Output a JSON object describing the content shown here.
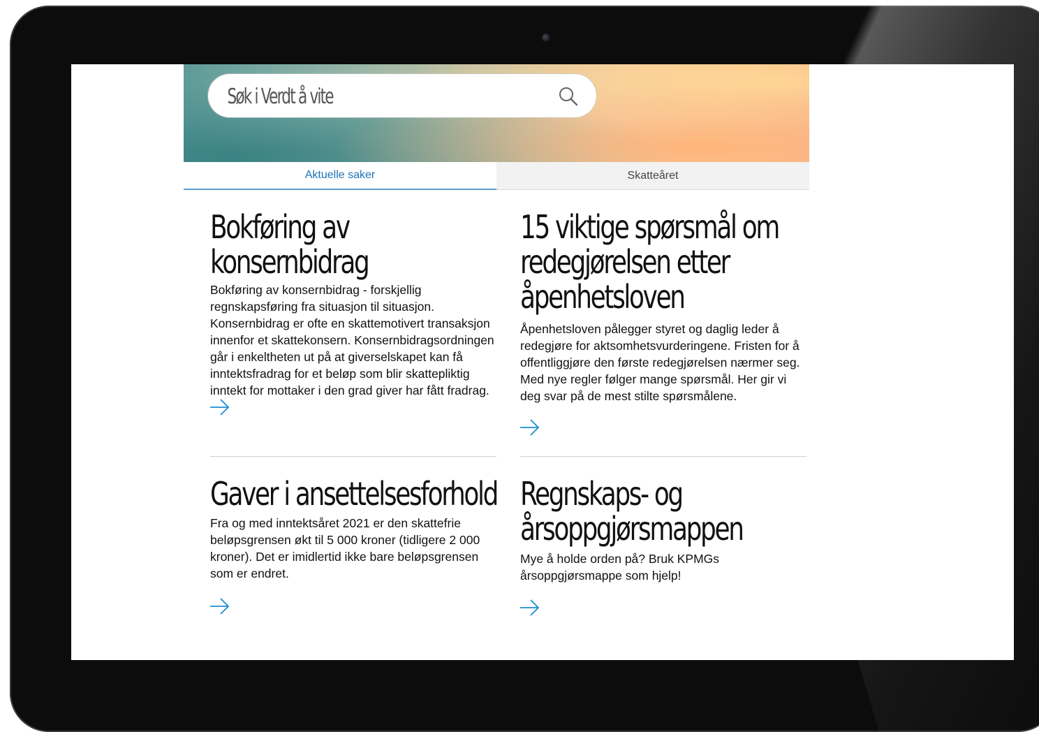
{
  "search": {
    "placeholder": "Søk i Verdt å vite"
  },
  "tabs": [
    {
      "label": "Aktuelle saker",
      "active": true
    },
    {
      "label": "Skatteåret",
      "active": false
    }
  ],
  "articles": [
    {
      "title": "Bokføring av konsernbidrag",
      "text": "Bokføring av konsernbidrag - forskjellig regnskapsføring fra situasjon til situasjon. Konsernbidrag er ofte en skattemotivert transaksjon innenfor et skattekonsern. Konsernbidragsordningen går i enkeltheten ut på at giverselskapet kan få inntektsfradrag for et beløp som blir skattepliktig inntekt for mottaker i den grad giver har fått fradrag."
    },
    {
      "title": "15 viktige spørsmål om redegjørelsen etter åpenhetsloven",
      "text": "Åpenhetsloven pålegger styret og daglig leder å redegjøre for aktsomhetsvurderingene. Fristen for å offentliggjøre den første redegjørelsen nærmer seg. Med nye regler følger mange spørsmål. Her gir vi deg svar på de mest stilte spørsmålene."
    },
    {
      "title": "Gaver i ansettelsesforhold",
      "text": "Fra og med inntektsåret 2021 er den skattefrie beløpsgrensen økt til 5 000 kroner (tidligere 2 000 kroner). Det er imidlertid ikke bare beløpsgrensen som er endret."
    },
    {
      "title": "Regnskaps- og årsoppgjørsmappen",
      "text": "Mye å holde orden på? Bruk KPMGs årsoppgjørsmappe som hjelp!"
    }
  ],
  "colors": {
    "accent": "#1a8fd0",
    "tab_active": "#1a72b8",
    "bezel": "#0c0c0c"
  },
  "icons": {
    "search": "search-icon",
    "read_more": "arrow-right-icon"
  }
}
